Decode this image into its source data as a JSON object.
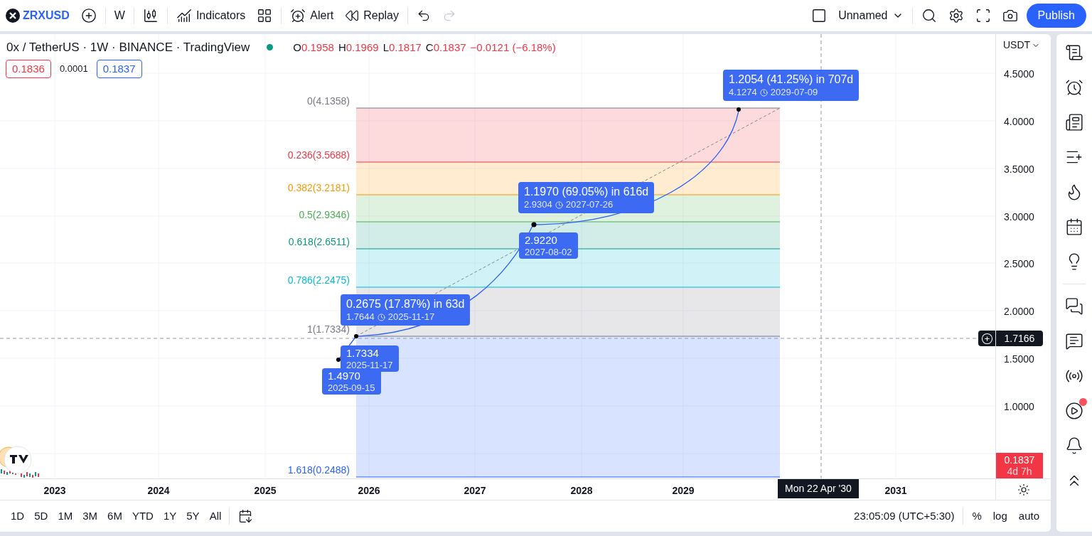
{
  "toolbar": {
    "symbol": "ZRXUSD",
    "interval": "W",
    "indicators": "Indicators",
    "alert": "Alert",
    "replay": "Replay",
    "undo": {
      "disabled": false
    },
    "redo": {
      "disabled": true
    },
    "layout_name": "Unnamed",
    "publish": "Publish"
  },
  "legend": {
    "title": "0x / TetherUS · 1W · BINANCE · TradingView",
    "ohlc": [
      {
        "label": "O",
        "value": "0.1958"
      },
      {
        "label": "H",
        "value": "0.1969"
      },
      {
        "label": "L",
        "value": "0.1817"
      },
      {
        "label": "C",
        "value": "0.1837"
      }
    ],
    "change": "−0.0121 (−6.18%)",
    "sell": "0.1836",
    "spread": "0.0001",
    "buy": "0.1837"
  },
  "fib_levels": [
    {
      "label": "0(4.1358)",
      "color": "#787b86"
    },
    {
      "label": "0.236(3.5688)",
      "color": "#f23645"
    },
    {
      "label": "0.382(3.2181)",
      "color": "#ff9800"
    },
    {
      "label": "0.5(2.9346)",
      "color": "#4caf50"
    },
    {
      "label": "0.618(2.6511)",
      "color": "#089981"
    },
    {
      "label": "0.786(2.2475)",
      "color": "#00bcd4"
    },
    {
      "label": "1(1.7334)",
      "color": "#787b86"
    },
    {
      "label": "1.618(0.2488)",
      "color": "#2962ff"
    }
  ],
  "range_labels": [
    {
      "text": "0.2675 (17.87%) in 63d",
      "value": "1.7644",
      "date": "2025-11-17"
    },
    {
      "text": "1.1970 (69.05%) in 616d",
      "value": "2.9304",
      "date": "2027-07-26"
    },
    {
      "text": "1.2054 (41.25%) in 707d",
      "value": "4.1274",
      "date": "2029-07-09"
    }
  ],
  "point_labels": [
    {
      "value": "1.7334",
      "date": "2025-11-17"
    },
    {
      "value": "1.4970",
      "date": "2025-09-15"
    },
    {
      "value": "2.9220",
      "date": "2027-08-02"
    }
  ],
  "price_axis": {
    "currency": "USDT",
    "ticks": [
      "4.5000",
      "4.0000",
      "3.5000",
      "3.0000",
      "2.5000",
      "2.0000",
      "1.5000",
      "1.0000"
    ],
    "crosshair_price": "1.7166",
    "last_price": "0.1837",
    "countdown": "4d 7h"
  },
  "time_axis": {
    "labels": [
      "2023",
      "2024",
      "2025",
      "2026",
      "2027",
      "2028",
      "2029",
      "2031"
    ],
    "crosshair_date": "Mon 22 Apr '30"
  },
  "bottom_bar": {
    "ranges": [
      "1D",
      "5D",
      "1M",
      "3M",
      "6M",
      "YTD",
      "1Y",
      "5Y",
      "All"
    ],
    "time": "23:05:09 (UTC+5:30)",
    "percent": "%",
    "log": "log",
    "auto": "auto"
  },
  "sidebar": {
    "has_badge": true
  }
}
